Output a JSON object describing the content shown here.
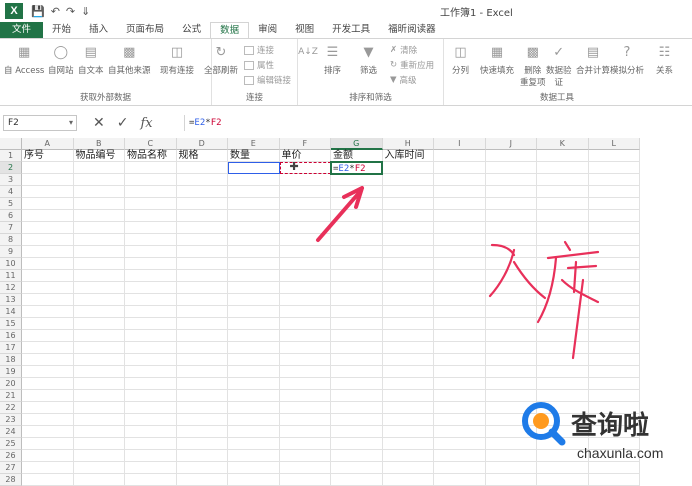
{
  "app": {
    "window_title": "工作簿1 - Excel",
    "logo": "X"
  },
  "tabs": [
    "文件",
    "开始",
    "插入",
    "页面布局",
    "公式",
    "数据",
    "审阅",
    "视图",
    "开发工具",
    "福昕阅读器"
  ],
  "active_tab": "数据",
  "ribbon": {
    "get_external": {
      "label": "获取外部数据",
      "buttons": [
        "自 Access",
        "自网站",
        "自文本",
        "自其他来源",
        "现有连接"
      ]
    },
    "connections": {
      "label": "连接",
      "refresh": "全部刷新",
      "small": [
        "连接",
        "属性",
        "编辑链接"
      ]
    },
    "sort_filter": {
      "label": "排序和筛选",
      "sort": "排序",
      "filter": "筛选",
      "small": [
        "清除",
        "重新应用",
        "高级"
      ]
    },
    "data_tools": {
      "label": "数据工具",
      "buttons": [
        "分列",
        "快速填充",
        "删除\n重复项",
        "数据验\n证",
        "合并计算",
        "模拟分析",
        "关系"
      ]
    }
  },
  "formula_bar": {
    "name_box": "F2",
    "cancel": "✕",
    "enter": "✓",
    "fx": "fx",
    "formula_prefix": "=",
    "formula_ref1": "E2",
    "formula_op": "*",
    "formula_ref2": "F2"
  },
  "sheet": {
    "columns": [
      "A",
      "B",
      "C",
      "D",
      "E",
      "F",
      "G",
      "H",
      "I",
      "J",
      "K",
      "L"
    ],
    "rows": [
      "1",
      "2",
      "3",
      "4",
      "5",
      "6",
      "7",
      "8",
      "9",
      "10",
      "11",
      "12",
      "13",
      "14",
      "15",
      "16",
      "17",
      "18",
      "19",
      "20",
      "21",
      "22",
      "23",
      "24",
      "25",
      "26",
      "27",
      "28"
    ],
    "row1": [
      "序号",
      "物品编号",
      "物品名称",
      "规格",
      "数量",
      "单价",
      "金额",
      "入库时间"
    ],
    "g2_prefix": "=",
    "g2_ref1": "E2",
    "g2_op": "*",
    "g2_ref2": "F2"
  },
  "colors": {
    "accent": "#217346",
    "ref_blue": "#2e5ee8",
    "ref_red": "#cc0033",
    "annotation": "#e8305a"
  },
  "annotation_handwriting": "入库",
  "watermark": {
    "text": "查询啦",
    "url": "chaxunla.com"
  }
}
